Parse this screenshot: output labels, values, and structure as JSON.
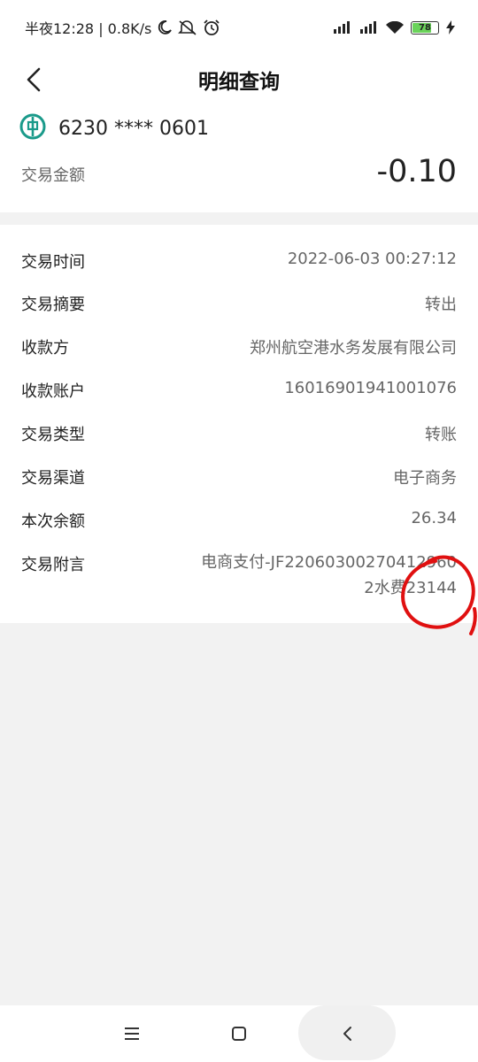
{
  "status_bar": {
    "time_text": "半夜12:28 | 0.8K/s",
    "battery_level": "78",
    "battery_fraction": 0.78,
    "icons": [
      "moon-icon",
      "silent-icon",
      "alarm-icon",
      "signal-icon",
      "signal-icon",
      "wifi-icon",
      "battery-icon",
      "charging-icon"
    ]
  },
  "header": {
    "title": "明细查询",
    "back_icon": "chevron-left-icon"
  },
  "account": {
    "bank_logo": "abc-bank-logo",
    "number": "6230 **** 0601",
    "amount_label": "交易金额",
    "amount": "-0.10"
  },
  "details": [
    {
      "label": "交易时间",
      "value": "2022-06-03 00:27:12"
    },
    {
      "label": "交易摘要",
      "value": "转出"
    },
    {
      "label": "收款方",
      "value": "郑州航空港水务发展有限公司"
    },
    {
      "label": "收款账户",
      "value": "16016901941001076"
    },
    {
      "label": "交易类型",
      "value": "转账"
    },
    {
      "label": "交易渠道",
      "value": "电子商务"
    },
    {
      "label": "本次余额",
      "value": "26.34"
    },
    {
      "label": "交易附言",
      "value": "电商支付-JF220603002704129602水费23144"
    }
  ],
  "colors": {
    "bank_green": "#1a9a8a",
    "annotation_red": "#e01010",
    "battery_green": "#6ad35a"
  },
  "nav_bar": {
    "icons": [
      "menu-icon",
      "home-square-icon",
      "back-chevron-icon"
    ]
  }
}
